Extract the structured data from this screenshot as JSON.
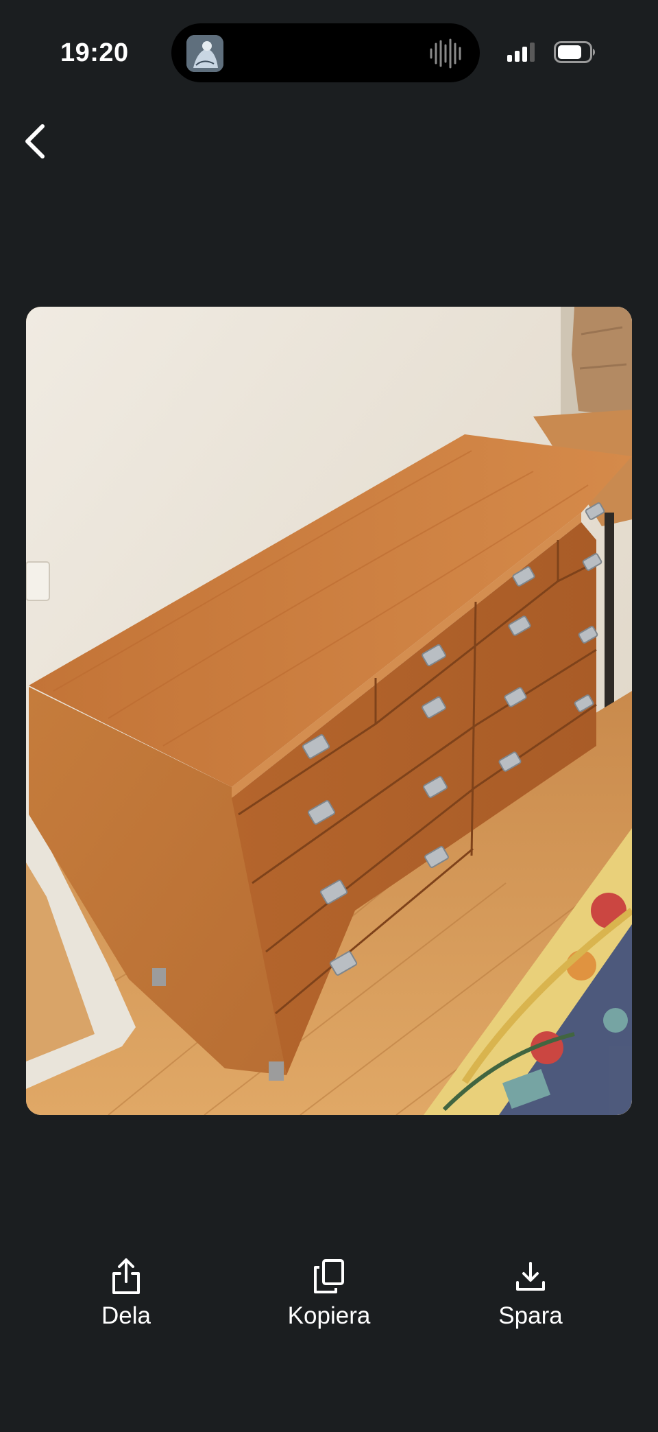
{
  "status_bar": {
    "time": "19:20",
    "icons": [
      "cellular-signal-icon",
      "battery-icon"
    ]
  },
  "navigation": {
    "back_icon": "chevron-left-icon"
  },
  "photo": {
    "subject": "furniture-photo"
  },
  "actions": [
    {
      "label": "Dela",
      "icon": "share-icon"
    },
    {
      "label": "Kopiera",
      "icon": "copy-icon"
    },
    {
      "label": "Spara",
      "icon": "download-icon"
    }
  ],
  "colors": {
    "background": "#1b1e20",
    "text": "#ffffff"
  }
}
